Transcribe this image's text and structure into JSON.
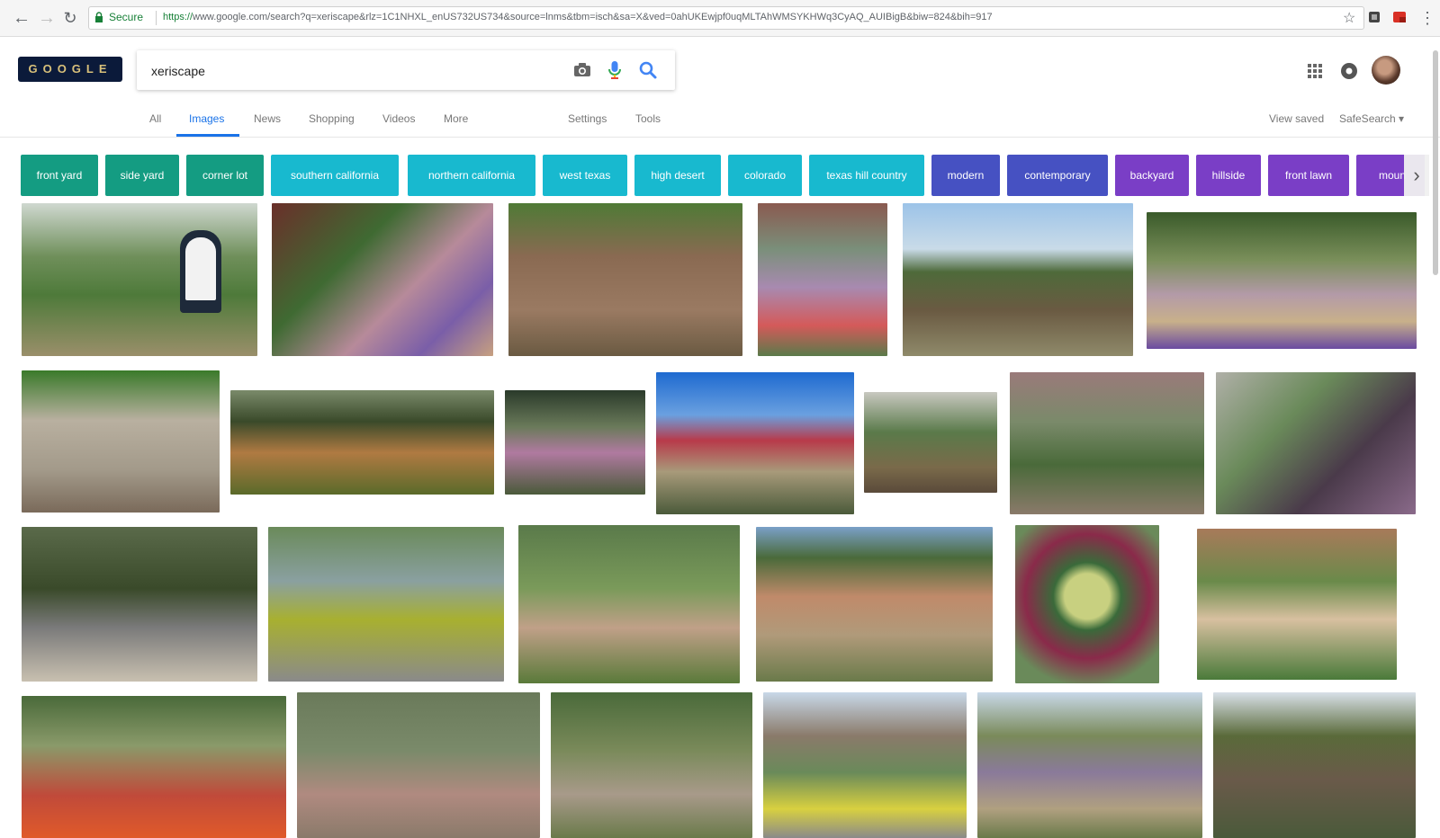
{
  "browser": {
    "secure_label": "Secure",
    "url_scheme": "https://",
    "url_rest": "www.google.com/search?q=xeriscape&rlz=1C1NHXL_enUS732US734&source=lnms&tbm=isch&sa=X&ved=0ahUKEwjpf0uqMLTAhWMSYKHWq3CyAQ_AUIBigB&biw=824&bih=917"
  },
  "search": {
    "query": "xeriscape"
  },
  "tabs": [
    {
      "label": "All"
    },
    {
      "label": "Images"
    },
    {
      "label": "News"
    },
    {
      "label": "Shopping"
    },
    {
      "label": "Videos"
    },
    {
      "label": "More"
    },
    {
      "label": "Settings"
    },
    {
      "label": "Tools"
    }
  ],
  "right_links": {
    "view_saved": "View saved",
    "safesearch": "SafeSearch ▾"
  },
  "chips": [
    {
      "label": "front yard",
      "color": "#149c82"
    },
    {
      "label": "side yard",
      "color": "#149c82"
    },
    {
      "label": "corner lot",
      "color": "#149c82"
    },
    {
      "label": "southern california",
      "color": "#18b9cf"
    },
    {
      "label": "northern california",
      "color": "#18b9cf"
    },
    {
      "label": "west texas",
      "color": "#18b9cf"
    },
    {
      "label": "high desert",
      "color": "#18b9cf"
    },
    {
      "label": "colorado",
      "color": "#18b9cf"
    },
    {
      "label": "texas hill country",
      "color": "#18b9cf"
    },
    {
      "label": "modern",
      "color": "#4651c2"
    },
    {
      "label": "contemporary",
      "color": "#4651c2"
    },
    {
      "label": "backyard",
      "color": "#7a3ec6"
    },
    {
      "label": "hillside",
      "color": "#7a3ec6"
    },
    {
      "label": "front lawn",
      "color": "#7a3ec6"
    },
    {
      "label": "moun",
      "color": "#7a3ec6"
    }
  ],
  "colors": {
    "accent": "#1a73e8",
    "secure": "#188038"
  }
}
